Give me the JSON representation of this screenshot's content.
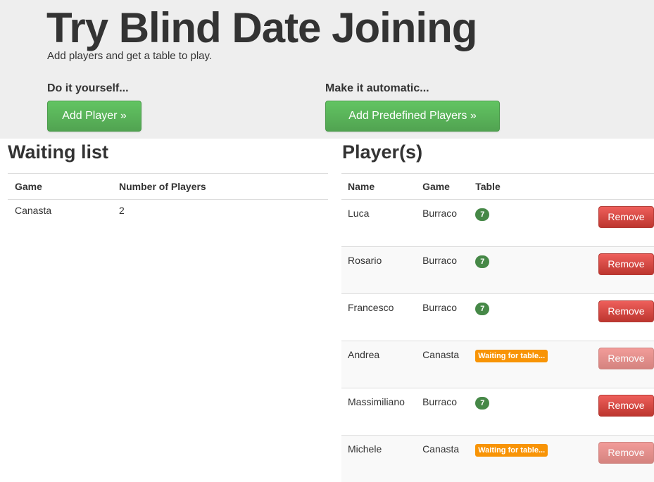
{
  "hero": {
    "title": "Try Blind Date Joining",
    "subtitle": "Add players and get a table to play.",
    "manual_heading": "Do it yourself...",
    "manual_button": "Add Player »",
    "auto_heading": "Make it automatic...",
    "auto_button": "Add Predefined Players »"
  },
  "waiting_list": {
    "title": "Waiting list",
    "columns": [
      "Game",
      "Number of Players"
    ],
    "rows": [
      {
        "game": "Canasta",
        "players": "2"
      }
    ]
  },
  "players": {
    "title": "Player(s)",
    "columns": [
      "Name",
      "Game",
      "Table"
    ],
    "remove_label": "Remove",
    "rows": [
      {
        "name": "Luca",
        "game": "Burraco",
        "table": "7",
        "status": "seated"
      },
      {
        "name": "Rosario",
        "game": "Burraco",
        "table": "7",
        "status": "seated"
      },
      {
        "name": "Francesco",
        "game": "Burraco",
        "table": "7",
        "status": "seated"
      },
      {
        "name": "Andrea",
        "game": "Canasta",
        "table": "Waiting for table...",
        "status": "waiting"
      },
      {
        "name": "Massimiliano",
        "game": "Burraco",
        "table": "7",
        "status": "seated"
      },
      {
        "name": "Michele",
        "game": "Canasta",
        "table": "Waiting for table...",
        "status": "waiting"
      }
    ]
  },
  "colors": {
    "success": "#51a351",
    "danger": "#bd362f",
    "badge_success": "#468847",
    "warning": "#f89406",
    "hero_bg": "#eeeeee"
  }
}
